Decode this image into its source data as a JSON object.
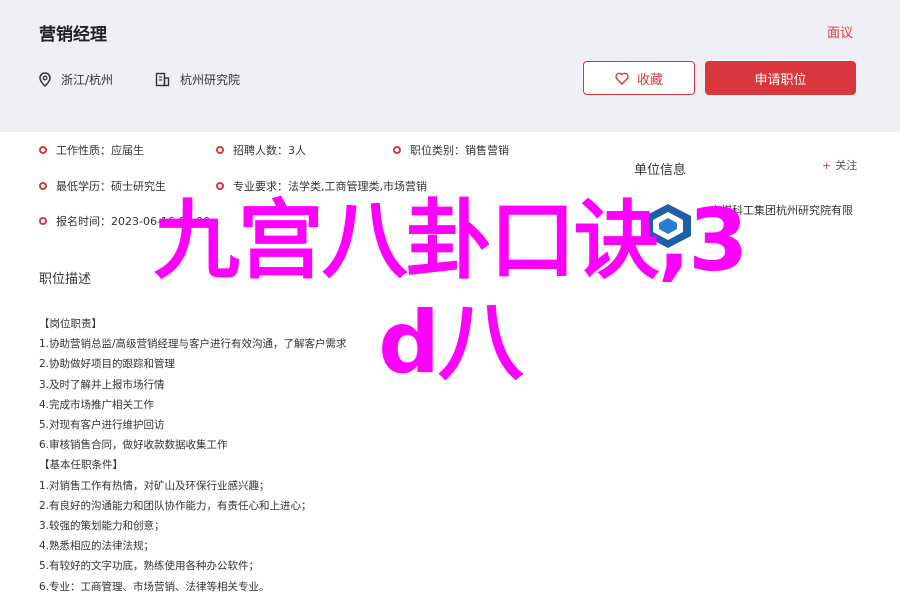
{
  "header": {
    "job_title": "营销经理",
    "report": "面议",
    "location": "浙江/杭州",
    "institute": "杭州研究院",
    "favorite_label": "收藏",
    "apply_label": "申请职位"
  },
  "info": [
    {
      "label": "工作性质：",
      "value": "应届生"
    },
    {
      "label": "招聘人数：",
      "value": "3人"
    },
    {
      "label": "职位类别：",
      "value": "销售营销"
    },
    {
      "label": "最低学历：",
      "value": "硕士研究生"
    },
    {
      "label": "专业要求：",
      "value": "法学类,工商管理类,市场营销"
    },
    {
      "label": "报名时间：",
      "value": "2023-06-16 00:00"
    }
  ],
  "description": {
    "title": "职位描述",
    "lines": [
      "【岗位职责】",
      "1.协助营销总监/高级营销经理与客户进行有效沟通，了解客户需求",
      "2.协助做好项目的跟踪和管理",
      "3.及时了解并上报市场行情",
      "4.完成市场推广相关工作",
      "5.对现有客户进行维护回访",
      "6.审核销售合同，做好收款数据收集工作",
      "【基本任职条件】",
      "1.对销售工作有热情，对矿山及环保行业感兴趣；",
      "2.有良好的沟通能力和团队协作能力，有责任心和上进心；",
      "3.较强的策划能力和创意；",
      "4.熟悉相应的法律法规；",
      "5.有较好的文字功底，熟练使用各种办公软件；",
      "6.专业：工商管理、市场营销、法律等相关专业。"
    ]
  },
  "sidebar": {
    "title": "单位信息",
    "follow": "关注",
    "company_name": "中煤科工集团杭州研究院有限"
  },
  "overlay": {
    "line1": "九宫八卦口诀,3",
    "line2": "d八"
  },
  "colors": {
    "accent": "#d9363e",
    "header_bg": "#eef0f6",
    "overlay": "#ff00ff"
  }
}
